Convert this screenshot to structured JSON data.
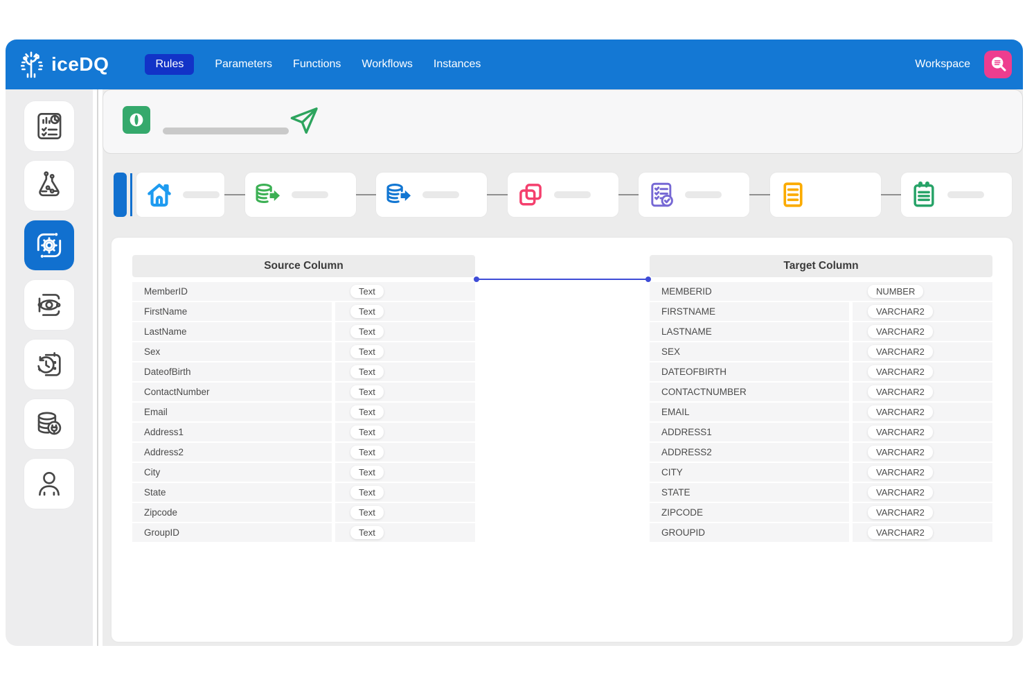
{
  "navbar": {
    "brand": "iceDQ",
    "items": [
      {
        "label": "Rules",
        "active": true
      },
      {
        "label": "Parameters",
        "active": false
      },
      {
        "label": "Functions",
        "active": false
      },
      {
        "label": "Workflows",
        "active": false
      },
      {
        "label": "Instances",
        "active": false
      }
    ],
    "workspace_label": "Workspace",
    "workspace_icon": "search-data-icon"
  },
  "sidebar": {
    "items": [
      {
        "icon": "report-summary-icon",
        "active": false
      },
      {
        "icon": "lab-flask-icon",
        "active": false
      },
      {
        "icon": "rule-engine-gear-icon",
        "active": true
      },
      {
        "icon": "data-sync-eye-icon",
        "active": false
      },
      {
        "icon": "schedule-history-icon",
        "active": false
      },
      {
        "icon": "database-connection-icon",
        "active": false
      },
      {
        "icon": "user-profile-icon",
        "active": false
      }
    ]
  },
  "toolbar": {
    "rule_badge_icon": "rule-type-o-icon",
    "name_skeleton": "",
    "send_icon": "paper-plane-icon"
  },
  "stepper": {
    "steps": [
      {
        "icon": "home-icon",
        "active": true,
        "has_skeleton": true
      },
      {
        "icon": "database-export-green-icon",
        "active": false,
        "has_skeleton": true
      },
      {
        "icon": "database-export-blue-icon",
        "active": false,
        "has_skeleton": true
      },
      {
        "icon": "overlap-squares-icon",
        "active": false,
        "has_skeleton": true
      },
      {
        "icon": "checklist-verified-icon",
        "active": false,
        "has_skeleton": true
      },
      {
        "icon": "document-lines-icon",
        "active": false,
        "has_skeleton": false
      },
      {
        "icon": "notepad-icon",
        "active": false,
        "has_skeleton": true
      }
    ]
  },
  "mapping": {
    "source": {
      "title": "Source Column",
      "rows": [
        {
          "name": "MemberID",
          "type": "Text"
        },
        {
          "name": "FirstName",
          "type": "Text"
        },
        {
          "name": "LastName",
          "type": "Text"
        },
        {
          "name": "Sex",
          "type": "Text"
        },
        {
          "name": "DateofBirth",
          "type": "Text"
        },
        {
          "name": "ContactNumber",
          "type": "Text"
        },
        {
          "name": "Email",
          "type": "Text"
        },
        {
          "name": "Address1",
          "type": "Text"
        },
        {
          "name": "Address2",
          "type": "Text"
        },
        {
          "name": "City",
          "type": "Text"
        },
        {
          "name": "State",
          "type": "Text"
        },
        {
          "name": "Zipcode",
          "type": "Text"
        },
        {
          "name": "GroupID",
          "type": "Text"
        }
      ]
    },
    "target": {
      "title": "Target Column",
      "rows": [
        {
          "name": "MEMBERID",
          "type": "NUMBER"
        },
        {
          "name": "FIRSTNAME",
          "type": "VARCHAR2"
        },
        {
          "name": "LASTNAME",
          "type": "VARCHAR2"
        },
        {
          "name": "SEX",
          "type": "VARCHAR2"
        },
        {
          "name": "DATEOFBIRTH",
          "type": "VARCHAR2"
        },
        {
          "name": "CONTACTNUMBER",
          "type": "VARCHAR2"
        },
        {
          "name": "EMAIL",
          "type": "VARCHAR2"
        },
        {
          "name": "ADDRESS1",
          "type": "VARCHAR2"
        },
        {
          "name": "ADDRESS2",
          "type": "VARCHAR2"
        },
        {
          "name": "CITY",
          "type": "VARCHAR2"
        },
        {
          "name": "STATE",
          "type": "VARCHAR2"
        },
        {
          "name": "ZIPCODE",
          "type": "VARCHAR2"
        },
        {
          "name": "GROUPID",
          "type": "VARCHAR2"
        }
      ]
    },
    "connection": {
      "from": "MemberID",
      "to": "MEMBERID"
    }
  },
  "colors": {
    "navbarBlue": "#1478d4",
    "activePill": "#1233c7",
    "workspacePink": "#ee3d8f",
    "stepActiveBlue": "#1170cf",
    "homeBlue": "#1e9bf0",
    "toolGreen": "#35a96c",
    "planeGreen": "#2da45e",
    "dbGreen": "#3cb054",
    "dbBlue": "#1276d2",
    "overlapPink": "#f43f6d",
    "checklistPurple": "#7668d4",
    "docOrange": "#fbab00",
    "clipGreen": "#27a368",
    "connectorIndigo": "#3e4cd7"
  }
}
